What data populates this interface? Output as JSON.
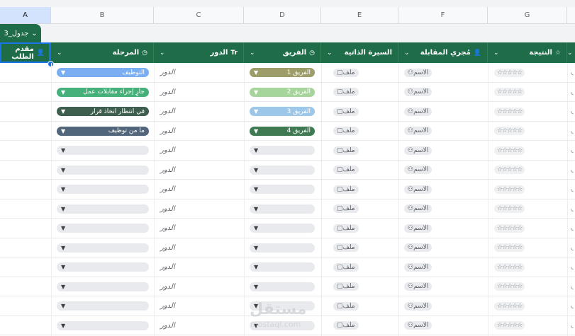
{
  "columns": [
    "A",
    "B",
    "C",
    "D",
    "E",
    "F",
    "G"
  ],
  "tab": {
    "label": "جدول_3",
    "chevron": "⌄"
  },
  "headers": [
    {
      "label": "مقدم الطلب",
      "icon": "person"
    },
    {
      "label": "المرحلة",
      "icon": "clock"
    },
    {
      "label": "الدور",
      "icon": "Tr"
    },
    {
      "label": "الفريق",
      "icon": "clock"
    },
    {
      "label": "السيرة الذاتية",
      "icon": ""
    },
    {
      "label": "مُجري المقابلة",
      "icon": "person"
    },
    {
      "label": "النتيجة",
      "icon": "star"
    }
  ],
  "stages": [
    {
      "label": "التوظيف",
      "color": "#7aaef2"
    },
    {
      "label": "جارٍ إجراء مقابلات عمل",
      "color": "#45b07a"
    },
    {
      "label": "في انتظار اتخاذ قرار",
      "color": "#3f5f4e"
    },
    {
      "label": "ما من توظيف",
      "color": "#51657b"
    }
  ],
  "teams": [
    {
      "label": "الفريق 1",
      "color": "#9d9d6a"
    },
    {
      "label": "الفريق 2",
      "color": "#a6d59b"
    },
    {
      "label": "الفريق 3",
      "color": "#9dc7e8"
    },
    {
      "label": "الفريق 4",
      "color": "#3f7a52"
    }
  ],
  "role_placeholder": "الدور",
  "resume_placeholder": "ملف",
  "interviewer_placeholder": "الاسم",
  "rating_placeholder": "☆☆☆☆☆",
  "watermark": {
    "main": "مستقل",
    "sub": "mostaql.com"
  },
  "row_count": 14
}
